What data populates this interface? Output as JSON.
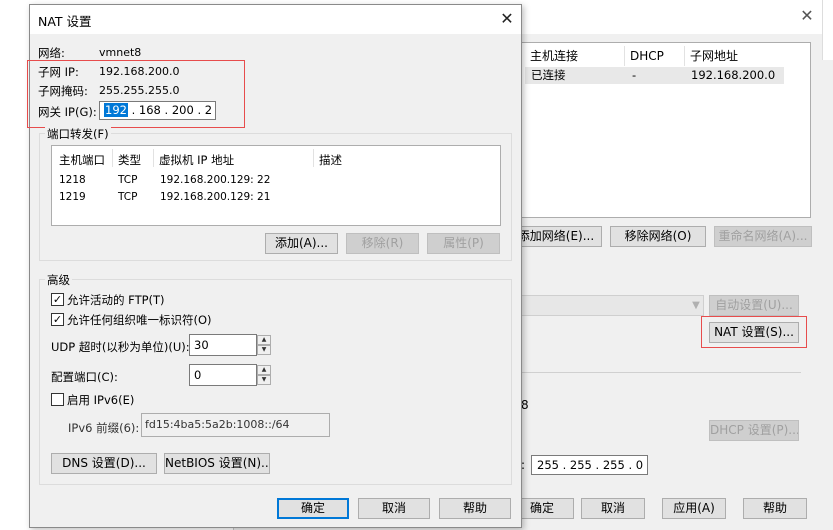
{
  "background_window": {
    "table": {
      "columns": [
        "主机连接",
        "DHCP",
        "子网地址"
      ],
      "selected_row": [
        "已连接",
        "-",
        "192.168.200.0"
      ]
    },
    "buttons": {
      "add_network": "添加网络(E)...",
      "remove_network": "移除网络(O)",
      "rename_network": "重命名网络(A)...",
      "auto_settings": "自动设置(U)...",
      "nat_settings": "NAT 设置(S)...",
      "dhcp_settings": "DHCP 设置(P)..."
    },
    "fragments": {
      "partial_8": "8",
      "colon": ":"
    },
    "subnet_mask_value": "255 . 255 . 255 . 0",
    "bottom_buttons": {
      "ok": "确定",
      "cancel": "取消",
      "apply": "应用(A)",
      "help": "帮助"
    }
  },
  "dialog": {
    "title": "NAT 设置",
    "network_label": "网络:",
    "network_value": "vmnet8",
    "subnet_ip_label": "子网 IP:",
    "subnet_ip_value": "192.168.200.0",
    "subnet_mask_label": "子网掩码:",
    "subnet_mask_value": "255.255.255.0",
    "gateway_label": "网关 IP(G):",
    "gateway_selected": "192",
    "gateway_rest": " . 168 . 200 .  2",
    "port_forwarding": {
      "title": "端口转发(F)",
      "columns": [
        "主机端口",
        "类型",
        "虚拟机 IP 地址",
        "描述"
      ],
      "rows": [
        {
          "port": "1218",
          "type": "TCP",
          "vm_ip": "192.168.200.129: 22"
        },
        {
          "port": "1219",
          "type": "TCP",
          "vm_ip": "192.168.200.129: 21"
        }
      ],
      "add_button": "添加(A)...",
      "remove_button": "移除(R)",
      "properties_button": "属性(P)"
    },
    "advanced": {
      "title": "高级",
      "allow_active_ftp": "允许活动的 FTP(T)",
      "allow_active_ftp_checked": true,
      "allow_any_oui": "允许任何组织唯一标识符(O)",
      "allow_any_oui_checked": true,
      "udp_timeout_label": "UDP 超时(以秒为单位)(U):",
      "udp_timeout_value": "30",
      "config_port_label": "配置端口(C):",
      "config_port_value": "0",
      "enable_ipv6_label": "启用 IPv6(E)",
      "enable_ipv6_checked": false,
      "ipv6_prefix_label": "IPv6 前缀(6):",
      "ipv6_prefix_value": "fd15:4ba5:5a2b:1008::/64",
      "dns_button": "DNS 设置(D)...",
      "netbios_button": "NetBIOS 设置(N)..."
    },
    "buttons": {
      "ok": "确定",
      "cancel": "取消",
      "help": "帮助"
    }
  },
  "colors": {
    "highlight_red": "#e74c4c",
    "selection_blue": "#0078d7",
    "dialog_bg": "#f0f0f0"
  }
}
